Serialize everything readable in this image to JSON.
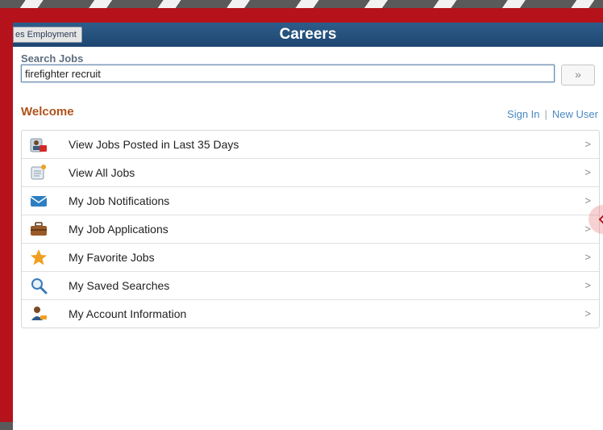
{
  "header": {
    "back_label": "es Employment",
    "title": "Careers"
  },
  "search": {
    "label": "Search Jobs",
    "value": "firefighter recruit",
    "button_label": "»"
  },
  "welcome": {
    "heading": "Welcome",
    "sign_in": "Sign In",
    "separator": "|",
    "new_user": "New User"
  },
  "menu": {
    "items": [
      {
        "label": "View Jobs Posted in Last 35 Days",
        "icon": "posted-jobs-icon"
      },
      {
        "label": "View All Jobs",
        "icon": "all-jobs-icon"
      },
      {
        "label": "My Job Notifications",
        "icon": "envelope-icon"
      },
      {
        "label": "My Job Applications",
        "icon": "briefcase-icon"
      },
      {
        "label": "My Favorite Jobs",
        "icon": "star-icon"
      },
      {
        "label": "My Saved Searches",
        "icon": "magnifier-icon"
      },
      {
        "label": "My Account Information",
        "icon": "user-account-icon"
      }
    ],
    "chevron": ">"
  },
  "colors": {
    "frame": "#b5121b",
    "header": "#1d4670",
    "welcome": "#b0531b",
    "link": "#4a88c0"
  }
}
